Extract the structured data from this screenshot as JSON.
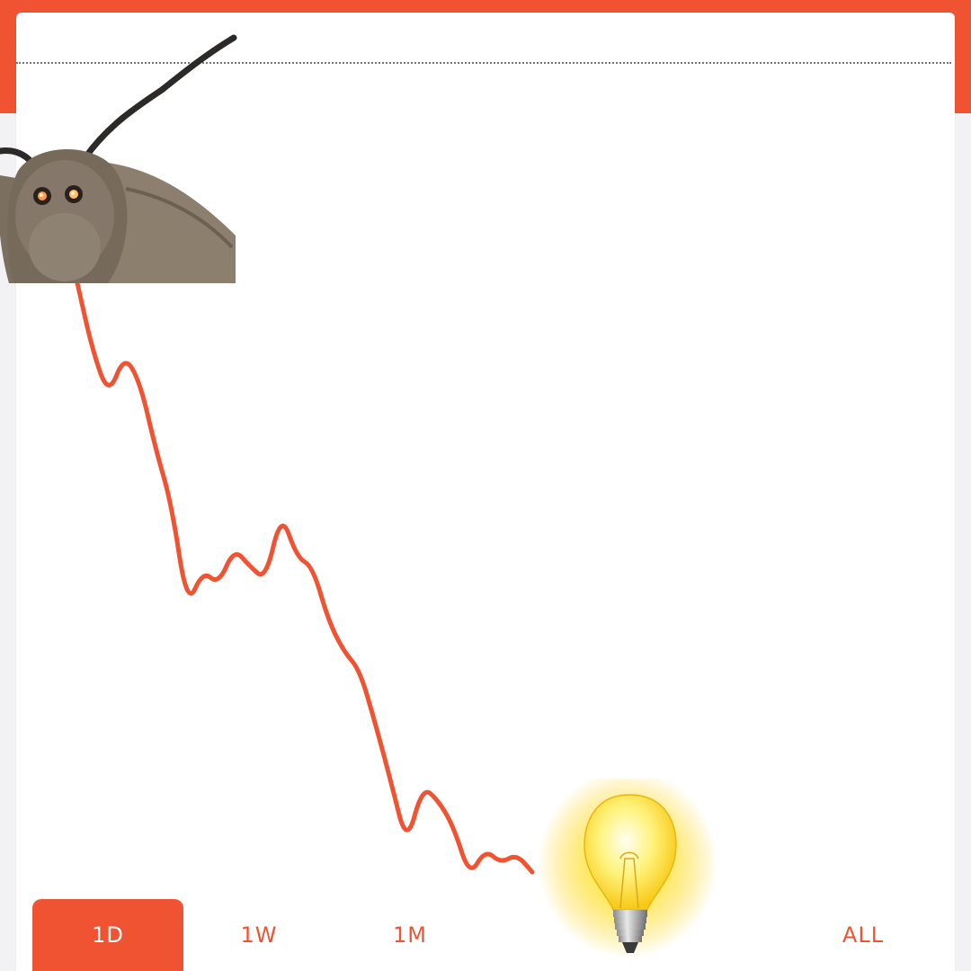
{
  "colors": {
    "accent": "#f05331",
    "card": "#ffffff",
    "background": "#f2f2f4"
  },
  "tabs": [
    {
      "label": "1D",
      "active": true
    },
    {
      "label": "1W",
      "active": false
    },
    {
      "label": "1M",
      "active": false
    },
    {
      "label": "",
      "active": false
    },
    {
      "label": "ALL",
      "active": false
    }
  ],
  "chart_data": {
    "type": "line",
    "title": "",
    "xlabel": "",
    "ylabel": "",
    "grid": false,
    "y": [
      315,
      392,
      440,
      395,
      425,
      500,
      560,
      675,
      635,
      650,
      610,
      630,
      645,
      570,
      620,
      630,
      690,
      725,
      745,
      805,
      870,
      940,
      875,
      890,
      920,
      975,
      945,
      960,
      950,
      970
    ]
  },
  "images": {
    "moth": "moth-illustration",
    "bulb": "lightbulb-illustration"
  }
}
